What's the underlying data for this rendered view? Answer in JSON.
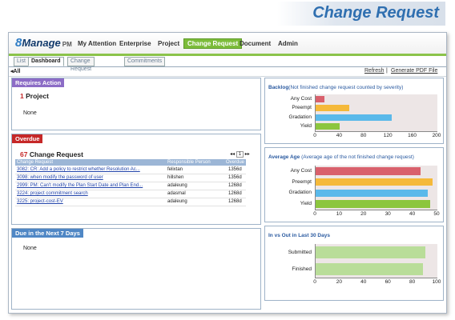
{
  "headline": "Change Request",
  "brand": {
    "logo_prefix": "8",
    "logo_word": "Manage",
    "logo_suffix": "PM"
  },
  "nav": [
    "My Attention",
    "Enterprise",
    "Project",
    "Change Request",
    "Document",
    "Admin"
  ],
  "subtabs": [
    "List",
    "Dashboard",
    "Change Request",
    "Commitments"
  ],
  "filter": {
    "scope": "All",
    "refresh": "Refresh",
    "separator": "|",
    "generate_pdf": "Generate PDF File"
  },
  "requires_action": {
    "title": "Requires Action",
    "count": "1",
    "label": "Project",
    "item": "None"
  },
  "overdue": {
    "title": "Overdue",
    "count": "67",
    "label": "Change Request",
    "pager_current": "1",
    "columns": [
      "Change Request",
      "Responsible Person",
      "Overdue"
    ],
    "rows": [
      {
        "title": "3082: CR: Add a policy  to restrict whether Resolution Ac...",
        "person": "felixtan",
        "overdue": "1356d"
      },
      {
        "title": "3098: when modify the password of user",
        "person": "hillshen",
        "overdue": "1356d"
      },
      {
        "title": "2999: PM: Can't modify the Plan Start Date and Plan End...",
        "person": "adaleung",
        "overdue": "1268d"
      },
      {
        "title": "3224: project commitment search",
        "person": "adasmal",
        "overdue": "1268d"
      },
      {
        "title": "3225: project-cost-EV",
        "person": "adaleung",
        "overdue": "1268d"
      }
    ]
  },
  "due_next": {
    "title": "Due in the Next 7 Days",
    "item": "None"
  },
  "colors": {
    "red": "#d9606c",
    "orange": "#f5b93a",
    "blue": "#5ab9ea",
    "green": "#8cc63e",
    "light_green": "#b9dd99",
    "purple_header": "#8c6cc6",
    "red_header": "#c62828",
    "blue_header": "#4f87c5"
  },
  "chart_data": [
    {
      "type": "bar",
      "title": "Backlog",
      "subtitle": "(Not finished change request counted by severity)",
      "categories": [
        "Any Cost",
        "Preempt",
        "Gradation",
        "Yield"
      ],
      "values": [
        15,
        55,
        125,
        40
      ],
      "xlim": [
        0,
        200
      ],
      "xticks": [
        "0",
        "40",
        "80",
        "120",
        "160",
        "200"
      ],
      "orientation": "horizontal"
    },
    {
      "type": "bar",
      "title": "Average Age",
      "subtitle": "(Average age of the not finished change request)",
      "categories": [
        "Any Cost",
        "Preempt",
        "Gradation",
        "Yield"
      ],
      "values": [
        43,
        48,
        46,
        47
      ],
      "xlim": [
        0,
        50
      ],
      "xticks": [
        "0",
        "10",
        "20",
        "30",
        "40",
        "50"
      ],
      "orientation": "horizontal"
    },
    {
      "type": "bar",
      "title": "In vs Out in Last 30 Days",
      "categories": [
        "Submitted",
        "Finished"
      ],
      "values": [
        90,
        88
      ],
      "xlim": [
        0,
        100
      ],
      "xticks": [
        "0",
        "20",
        "40",
        "60",
        "80",
        "100"
      ],
      "orientation": "horizontal"
    }
  ]
}
